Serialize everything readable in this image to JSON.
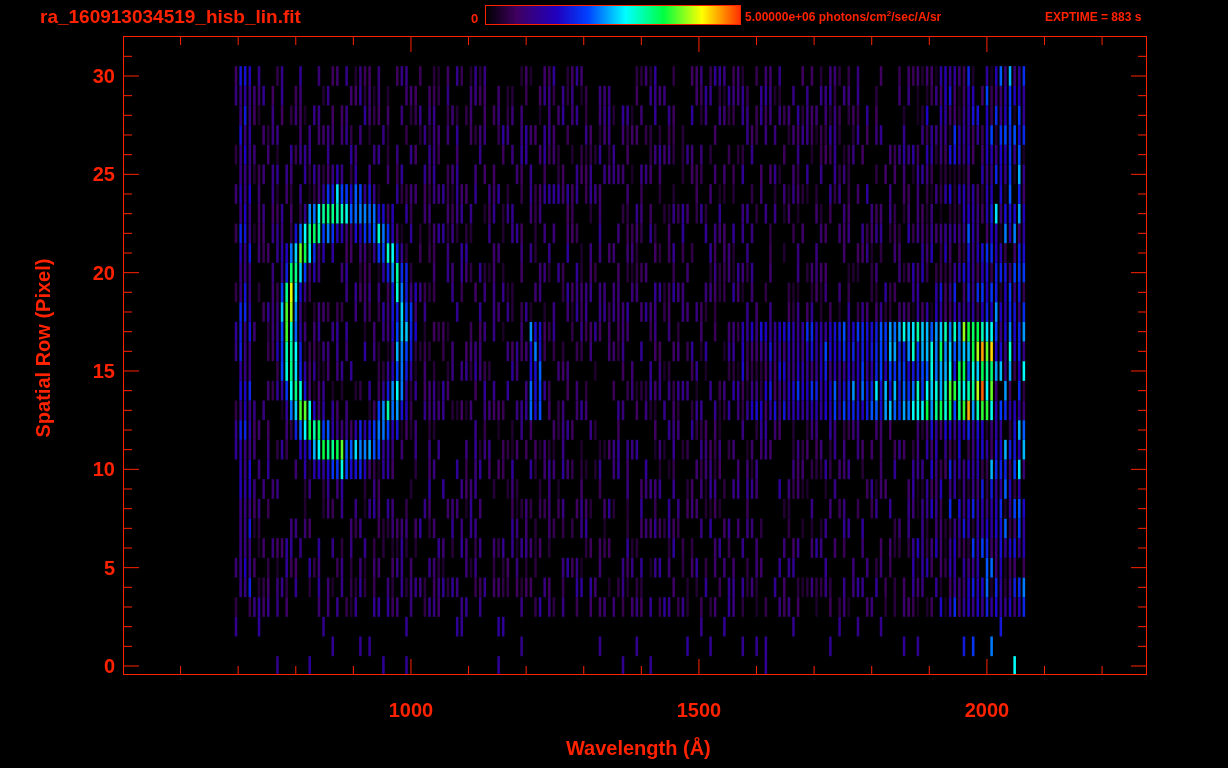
{
  "title": "ra_160913034519_hisb_lin.fit",
  "colorbar": {
    "min_label": "0",
    "max_label": "5.00000e+06 photons/cm$^{2}$/sec/A/sr"
  },
  "exptime": "EXPTIME = 883 s",
  "plot": {
    "xlabel": "Wavelength (Å)",
    "ylabel": "Spatial Row (Pixel)",
    "xticks": [
      "1000",
      "1500",
      "2000"
    ],
    "yticks": [
      "30",
      "25",
      "20",
      "15",
      "10",
      "5",
      "0"
    ]
  }
}
